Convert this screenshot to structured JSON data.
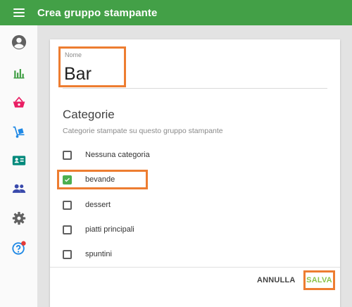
{
  "app": {
    "title": "Crea gruppo stampante"
  },
  "sidebar": {
    "items": [
      {
        "icon": "account-circle-icon",
        "color": "#616161"
      },
      {
        "icon": "bar-chart-icon",
        "color": "#43a047"
      },
      {
        "icon": "shopping-basket-icon",
        "color": "#e91e63"
      },
      {
        "icon": "hand-truck-icon",
        "color": "#1e88e5"
      },
      {
        "icon": "contact-card-icon",
        "color": "#00897b"
      },
      {
        "icon": "people-icon",
        "color": "#3949ab"
      },
      {
        "icon": "gear-icon",
        "color": "#616161"
      },
      {
        "icon": "help-icon",
        "color": "#1e88e5",
        "badge_color": "#e53935"
      }
    ]
  },
  "form": {
    "name_label": "Nome",
    "name_value": "Bar",
    "section_title": "Categorie",
    "section_subtitle": "Categorie stampate su questo gruppo stampante",
    "categories": [
      {
        "label": "Nessuna categoria",
        "checked": false
      },
      {
        "label": "bevande",
        "checked": true
      },
      {
        "label": "dessert",
        "checked": false
      },
      {
        "label": "piatti principali",
        "checked": false
      },
      {
        "label": "spuntini",
        "checked": false
      }
    ]
  },
  "actions": {
    "cancel_label": "ANNULLA",
    "save_label": "SALVA"
  },
  "colors": {
    "primary": "#43a047",
    "highlight": "#ed7d31",
    "save_text": "#8bc34a"
  }
}
